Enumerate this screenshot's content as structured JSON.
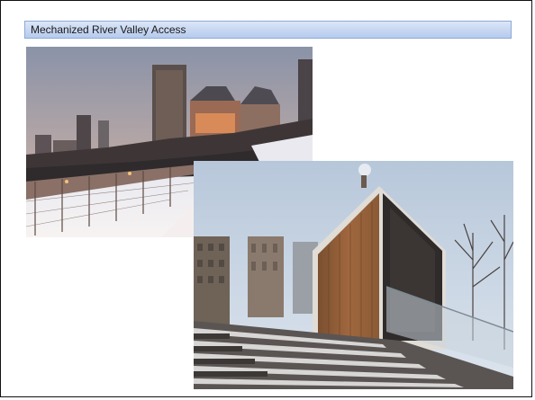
{
  "slide": {
    "title": "Mechanized River Valley Access"
  },
  "photos": [
    {
      "id": "walkway",
      "subject": "snowy walkway photo"
    },
    {
      "id": "pavilion",
      "subject": "wooden pavilion photo"
    }
  ],
  "colors": {
    "title_bar_border": "#8ea9d6",
    "title_bar_fill": "#c6d6f1",
    "slide_border": "#111111"
  }
}
